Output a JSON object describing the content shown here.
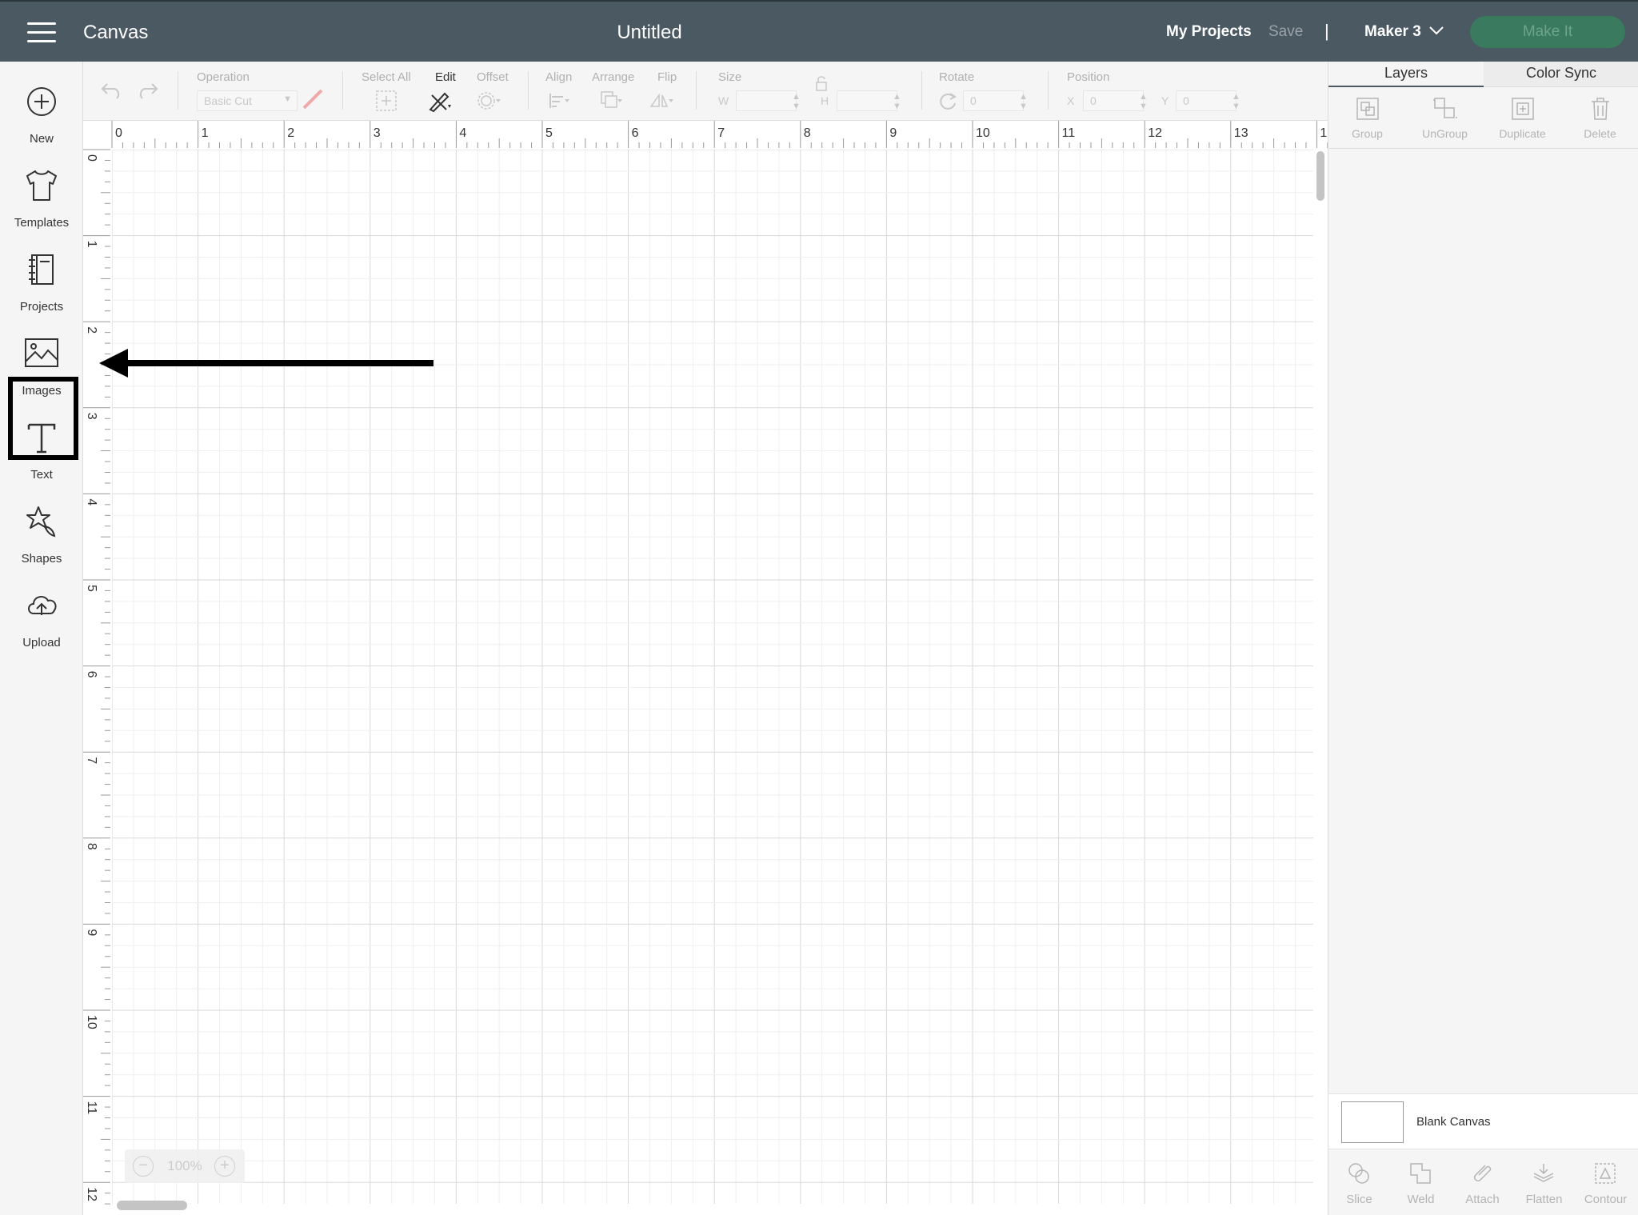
{
  "header": {
    "app_title": "Canvas",
    "doc_title": "Untitled",
    "my_projects": "My Projects",
    "save": "Save",
    "separator": "|",
    "machine": "Maker 3",
    "make_it": "Make It"
  },
  "sidebar": {
    "items": [
      {
        "label": "New",
        "icon": "plus-circle-icon"
      },
      {
        "label": "Templates",
        "icon": "tshirt-icon"
      },
      {
        "label": "Projects",
        "icon": "notebook-icon"
      },
      {
        "label": "Images",
        "icon": "image-icon"
      },
      {
        "label": "Text",
        "icon": "text-icon"
      },
      {
        "label": "Shapes",
        "icon": "shapes-icon"
      },
      {
        "label": "Upload",
        "icon": "cloud-upload-icon"
      }
    ],
    "highlighted": "Images"
  },
  "toolbar": {
    "operation_label": "Operation",
    "operation_value": "Basic Cut",
    "select_all_label": "Select All",
    "edit_label": "Edit",
    "offset_label": "Offset",
    "align_label": "Align",
    "arrange_label": "Arrange",
    "flip_label": "Flip",
    "size_label": "Size",
    "w_label": "W",
    "h_label": "H",
    "rotate_label": "Rotate",
    "rotate_value": "0",
    "position_label": "Position",
    "x_label": "X",
    "x_value": "0",
    "y_label": "Y",
    "y_value": "0"
  },
  "right_panel": {
    "tabs": [
      "Layers",
      "Color Sync"
    ],
    "actions": [
      "Group",
      "UnGroup",
      "Duplicate",
      "Delete"
    ],
    "blank_canvas": "Blank Canvas",
    "bottom_actions": [
      "Slice",
      "Weld",
      "Attach",
      "Flatten",
      "Contour"
    ]
  },
  "canvas": {
    "ruler_top": [
      "0",
      "1",
      "2",
      "3",
      "4",
      "5",
      "6",
      "7",
      "8",
      "9",
      "10",
      "11",
      "12",
      "13",
      "1"
    ],
    "ruler_left": [
      "0",
      "1",
      "2",
      "3",
      "4",
      "5",
      "6",
      "7",
      "8",
      "9",
      "10",
      "11",
      "12"
    ],
    "zoom": "100%",
    "zoom_minus": "−",
    "zoom_plus": "+"
  },
  "colors": {
    "topbar": "#4b5963",
    "make_it_bg": "#3a7a5e",
    "grid_major": "#d9d9d9",
    "grid_minor": "#efefef"
  }
}
